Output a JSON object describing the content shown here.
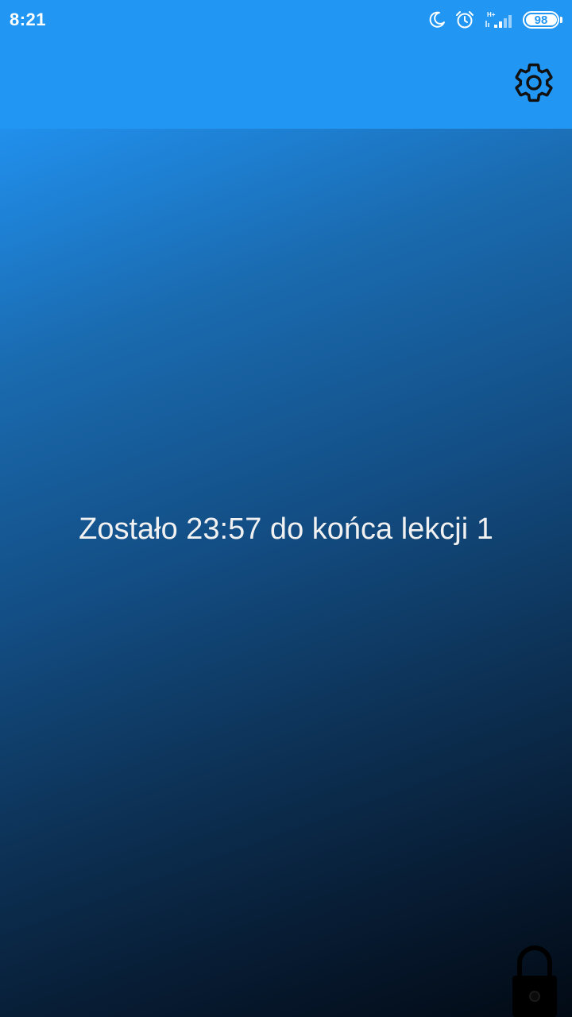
{
  "status_bar": {
    "time": "8:21",
    "network_type": "H+",
    "battery_level": "98",
    "icons": [
      "moon-icon",
      "alarm-clock-icon",
      "signal-icon",
      "battery-icon"
    ]
  },
  "app_bar": {
    "settings_icon": "gear-icon"
  },
  "main": {
    "countdown_text": "Zostało 23:57 do końca lekcji 1",
    "lock_icon": "lock-icon"
  },
  "colors": {
    "primary": "#2196f3",
    "gradient_end": "#020a14",
    "text": "#f1f1f1"
  }
}
